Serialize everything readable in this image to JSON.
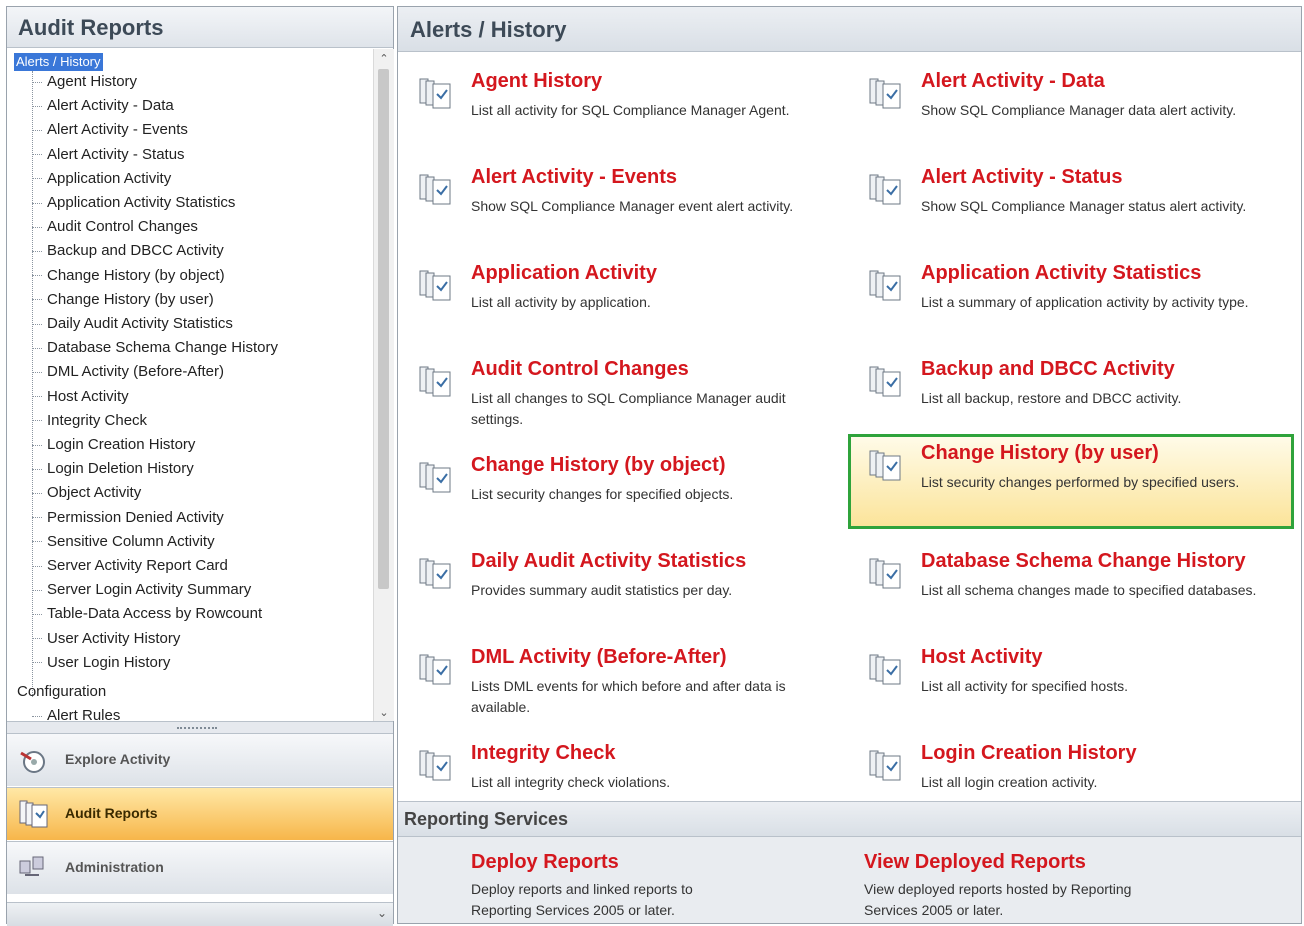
{
  "left_panel": {
    "title": "Audit Reports",
    "tree_root": "Alerts / History",
    "tree_items": [
      "Agent History",
      "Alert Activity - Data",
      "Alert Activity - Events",
      "Alert Activity - Status",
      "Application Activity",
      "Application Activity Statistics",
      "Audit Control Changes",
      "Backup and DBCC Activity",
      "Change History (by object)",
      "Change History (by user)",
      "Daily Audit Activity Statistics",
      "Database Schema Change History",
      "DML Activity (Before-After)",
      "Host Activity",
      "Integrity Check",
      "Login Creation History",
      "Login Deletion History",
      "Object Activity",
      "Permission Denied Activity",
      "Sensitive Column Activity",
      "Server Activity Report Card",
      "Server Login Activity Summary",
      "Table-Data Access by Rowcount",
      "User Activity History",
      "User Login History"
    ],
    "config_label": "Configuration",
    "config_first_child": "Alert Rules",
    "nav_buttons": [
      {
        "label": "Explore Activity",
        "icon": "explore-activity-icon",
        "active": false
      },
      {
        "label": "Audit Reports",
        "icon": "audit-reports-icon",
        "active": true
      },
      {
        "label": "Administration",
        "icon": "administration-icon",
        "active": false
      }
    ]
  },
  "main": {
    "title": "Alerts  /  History",
    "reports": [
      {
        "title": "Agent History",
        "desc": "List all activity for SQL Compliance Manager Agent."
      },
      {
        "title": "Alert Activity - Data",
        "desc": "Show SQL Compliance Manager data alert activity."
      },
      {
        "title": "Alert Activity - Events",
        "desc": "Show SQL Compliance Manager event alert activity."
      },
      {
        "title": "Alert Activity - Status",
        "desc": "Show SQL Compliance Manager status alert activity."
      },
      {
        "title": "Application Activity",
        "desc": "List all activity by application."
      },
      {
        "title": "Application Activity Statistics",
        "desc": "List a summary of application activity by activity type."
      },
      {
        "title": "Audit Control Changes",
        "desc": "List all changes to SQL Compliance Manager audit settings."
      },
      {
        "title": "Backup and DBCC Activity",
        "desc": "List all backup, restore and DBCC activity."
      },
      {
        "title": "Change History (by object)",
        "desc": "List security changes for specified objects."
      },
      {
        "title": "Change History (by user)",
        "desc": "List security changes performed by specified users."
      },
      {
        "title": "Daily Audit Activity Statistics",
        "desc": "Provides summary audit statistics per day."
      },
      {
        "title": "Database Schema Change History",
        "desc": "List all schema changes made to specified databases."
      },
      {
        "title": "DML Activity (Before-After)",
        "desc": "Lists DML events for which before and after data is available."
      },
      {
        "title": "Host Activity",
        "desc": "List all activity for specified hosts."
      },
      {
        "title": "Integrity Check",
        "desc": "List all integrity check violations."
      },
      {
        "title": "Login Creation History",
        "desc": "List all login creation activity."
      }
    ],
    "selected_report": "Change History (by user)",
    "reporting_services": {
      "header": "Reporting Services",
      "items": [
        {
          "title": "Deploy Reports",
          "desc": "Deploy reports and linked reports to Reporting Services 2005 or later."
        },
        {
          "title": "View Deployed Reports",
          "desc": "View deployed reports hosted by Reporting Services 2005 or later."
        }
      ]
    }
  },
  "colors": {
    "link_red": "#d4171e",
    "selection_green": "#2fa33b",
    "active_nav_orange": "#f7b64a",
    "tree_selection_blue": "#3a77d8"
  }
}
